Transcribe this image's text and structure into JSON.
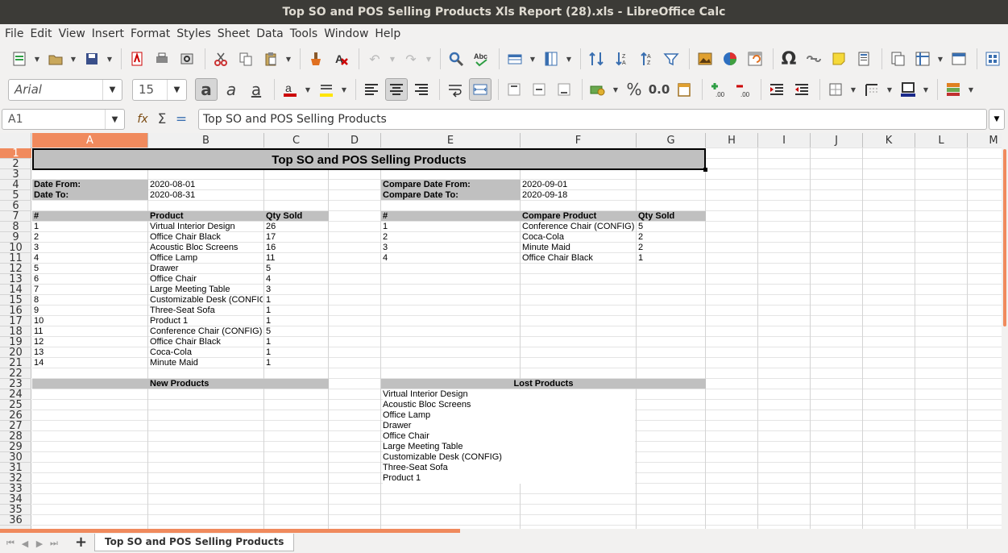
{
  "window": {
    "title": "Top SO and POS Selling Products Xls Report (28).xls - LibreOffice Calc"
  },
  "menu": [
    "File",
    "Edit",
    "View",
    "Insert",
    "Format",
    "Styles",
    "Sheet",
    "Data",
    "Tools",
    "Window",
    "Help"
  ],
  "toolbar2": {
    "font_name": "Arial",
    "font_size": "15",
    "number_format_decimal": "0.0"
  },
  "formula_bar": {
    "name_box": "A1",
    "content": "Top SO and POS Selling Products",
    "sum_icon": "Σ",
    "equals_icon": "="
  },
  "columns": [
    "A",
    "B",
    "C",
    "D",
    "E",
    "F",
    "G",
    "H",
    "I",
    "J",
    "K",
    "L",
    "M"
  ],
  "rows": [
    "1",
    "2",
    "3",
    "4",
    "5",
    "6",
    "7",
    "8",
    "9",
    "10",
    "11",
    "12",
    "13",
    "14",
    "15",
    "16",
    "17",
    "18",
    "19",
    "20",
    "21",
    "22",
    "23",
    "24",
    "25",
    "26",
    "27",
    "28",
    "29",
    "30",
    "31",
    "32",
    "33",
    "34",
    "35",
    "36"
  ],
  "sheet": {
    "title": "Top SO and POS Selling Products",
    "date_from_label": "Date From:",
    "date_from": "2020-08-01",
    "date_to_label": "Date To:",
    "date_to": "2020-08-31",
    "compare_from_label": "Compare Date From:",
    "compare_from": "2020-09-01",
    "compare_to_label": "Compare Date To:",
    "compare_to": "2020-09-18",
    "left_headers": [
      "#",
      "Product",
      "Qty Sold"
    ],
    "right_headers": [
      "#",
      "Compare Product",
      "Qty Sold"
    ],
    "left_rows": [
      [
        "1",
        "Virtual Interior Design",
        "26"
      ],
      [
        "2",
        "Office Chair Black",
        "17"
      ],
      [
        "3",
        "Acoustic Bloc Screens",
        "16"
      ],
      [
        "4",
        "Office Lamp",
        "11"
      ],
      [
        "5",
        "Drawer",
        "5"
      ],
      [
        "6",
        "Office Chair",
        "4"
      ],
      [
        "7",
        "Large Meeting Table",
        "3"
      ],
      [
        "8",
        "Customizable Desk (CONFIG)",
        "1"
      ],
      [
        "9",
        "Three-Seat Sofa",
        "1"
      ],
      [
        "10",
        "Product 1",
        "1"
      ],
      [
        "11",
        "Conference Chair (CONFIG)",
        "5"
      ],
      [
        "12",
        "Office Chair Black",
        "1"
      ],
      [
        "13",
        "Coca-Cola",
        "1"
      ],
      [
        "14",
        "Minute Maid",
        "1"
      ]
    ],
    "right_rows": [
      [
        "1",
        "Conference Chair (CONFIG)",
        "5"
      ],
      [
        "2",
        "Coca-Cola",
        "2"
      ],
      [
        "3",
        "Minute Maid",
        "2"
      ],
      [
        "4",
        "Office Chair Black",
        "1"
      ]
    ],
    "new_products_label": "New Products",
    "lost_products_label": "Lost Products",
    "lost_products": [
      "Virtual Interior Design",
      "Acoustic Bloc Screens",
      "Office Lamp",
      "Drawer",
      "Office Chair",
      "Large Meeting Table",
      "Customizable Desk (CONFIG)",
      "Three-Seat Sofa",
      "Product 1"
    ]
  },
  "sheet_tab": "Top SO and POS Selling Products",
  "colors": {
    "accent": "#f08a5d",
    "header_fill": "#c0c0c0",
    "titlebar": "#3c3b37"
  }
}
